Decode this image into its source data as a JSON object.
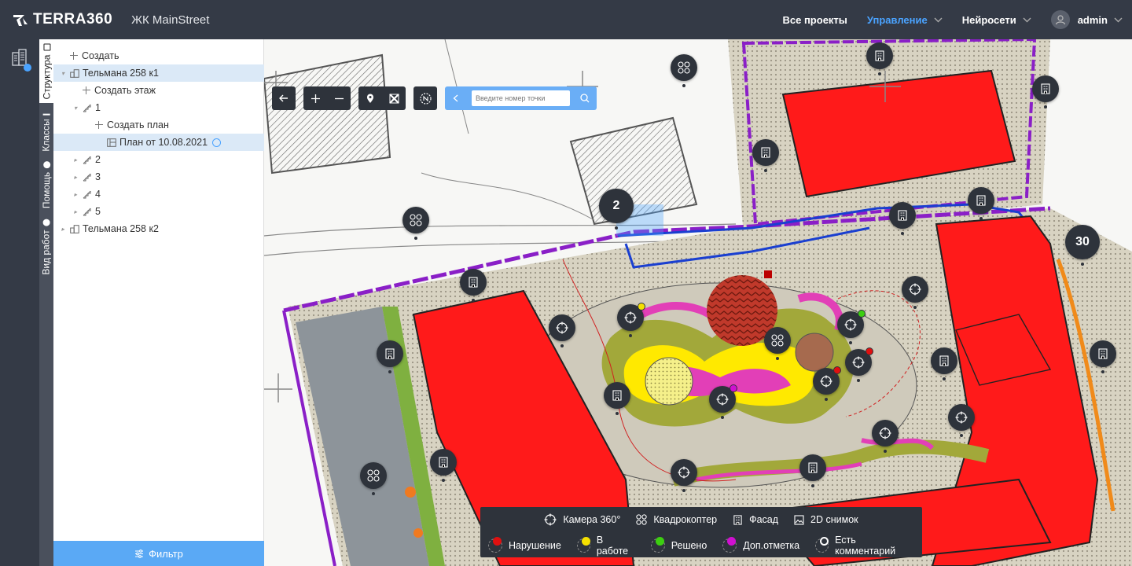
{
  "header": {
    "logo": "TERRA360",
    "project": "ЖК MainStreet",
    "nav": [
      {
        "label": "Все проекты",
        "active": false,
        "dropdown": false
      },
      {
        "label": "Управление",
        "active": true,
        "dropdown": true
      },
      {
        "label": "Нейросети",
        "active": false,
        "dropdown": true
      }
    ],
    "user": "admin",
    "accent": "#4aa3ff"
  },
  "side_tabs": [
    "Структура",
    "Классы",
    "Помощь",
    "Вид работ"
  ],
  "tree": [
    {
      "label": "Создать",
      "type": "create"
    },
    {
      "label": "Тельмана 258 к1",
      "type": "building",
      "selected": true
    },
    {
      "label": "Создать этаж",
      "type": "create"
    },
    {
      "label": "1",
      "type": "floor",
      "expanded": true
    },
    {
      "label": "Создать план",
      "type": "create"
    },
    {
      "label": "План от 10.08.2021",
      "type": "plan",
      "selected": true
    },
    {
      "label": "2",
      "type": "floor"
    },
    {
      "label": "3",
      "type": "floor"
    },
    {
      "label": "4",
      "type": "floor"
    },
    {
      "label": "5",
      "type": "floor"
    },
    {
      "label": "Тельмана 258 к2",
      "type": "building"
    }
  ],
  "filter_label": "Фильтр",
  "search": {
    "placeholder": "Введите номер точки"
  },
  "clusters": [
    "2",
    "30"
  ],
  "legend": {
    "types": [
      "Камера 360°",
      "Квадрокоптер",
      "Фасад",
      "2D снимок"
    ],
    "statuses": [
      {
        "label": "Нарушение",
        "color": "#e01010"
      },
      {
        "label": "В работе",
        "color": "#f5e000"
      },
      {
        "label": "Решено",
        "color": "#3ccf10"
      },
      {
        "label": "Доп.отметка",
        "color": "#d010d0"
      },
      {
        "label": "Есть комментарий",
        "color": "#ffffff"
      }
    ]
  }
}
